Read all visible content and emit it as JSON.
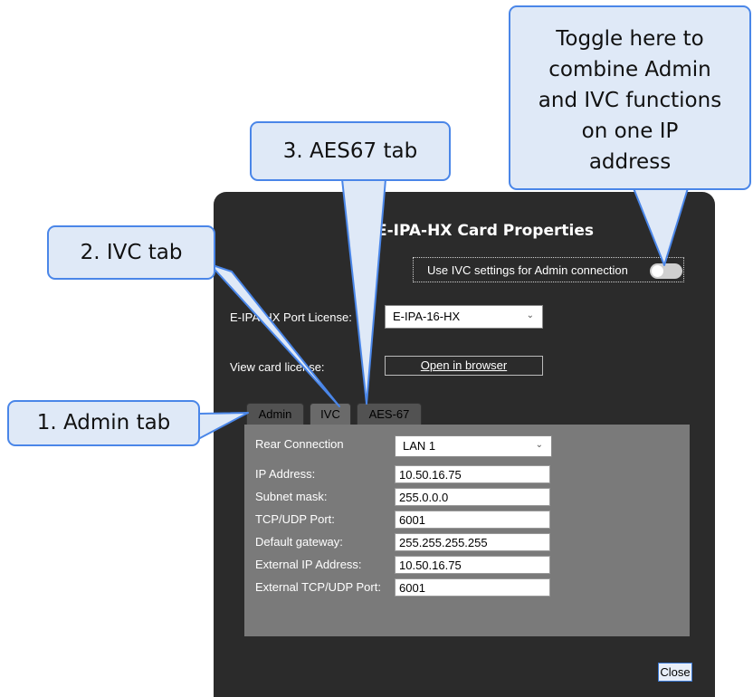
{
  "dialog": {
    "title": "E-IPA-HX Card Properties",
    "toggle": {
      "label": "Use IVC settings for Admin connection",
      "state": "off"
    },
    "license": {
      "label": "E-IPA-HX Port License:",
      "value": "E-IPA-16-HX"
    },
    "view_license": {
      "label": "View card license:",
      "button": "Open in browser"
    },
    "tabs": [
      {
        "label": "Admin"
      },
      {
        "label": "IVC",
        "active": true
      },
      {
        "label": "AES-67"
      }
    ],
    "form": {
      "rear_connection": {
        "label": "Rear Connection",
        "value": "LAN 1"
      },
      "fields": [
        {
          "label": "IP Address:",
          "value": "10.50.16.75"
        },
        {
          "label": "Subnet mask:",
          "value": "255.0.0.0"
        },
        {
          "label": "TCP/UDP Port:",
          "value": "6001"
        },
        {
          "label": "Default gateway:",
          "value": "255.255.255.255"
        },
        {
          "label": "External IP Address:",
          "value": "10.50.16.75"
        },
        {
          "label": "External TCP/UDP Port:",
          "value": "6001"
        }
      ]
    },
    "close_button": "Close"
  },
  "callouts": {
    "admin_tab": "1. Admin tab",
    "ivc_tab": "2. IVC tab",
    "aes67_tab": "3. AES67 tab",
    "toggle_line1": "Toggle here to",
    "toggle_line2": "combine Admin",
    "toggle_line3": "and IVC functions",
    "toggle_line4": "on one IP",
    "toggle_line5": "address"
  },
  "colors": {
    "dialog_bg": "#2b2b2b",
    "panel_bg": "#7a7a7a",
    "callout_fill": "#dfe9f7",
    "callout_border": "#4a86e8"
  }
}
